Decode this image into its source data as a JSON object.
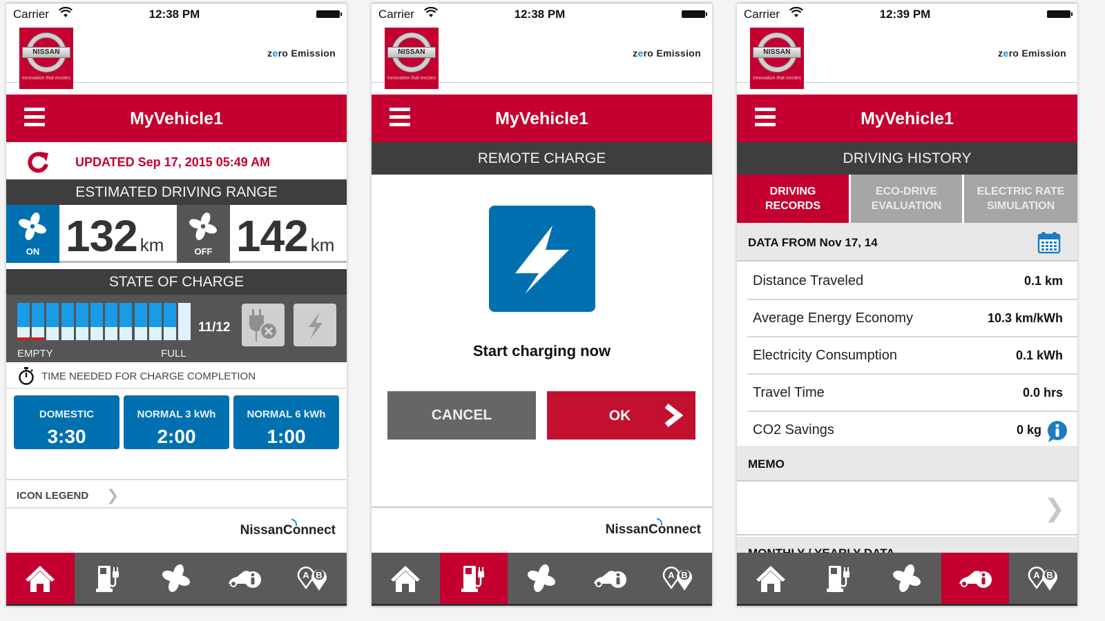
{
  "colors": {
    "brand_red": "#c3002f",
    "nissan_blue": "#0070b0",
    "dark_header": "#3e3e3e",
    "tabbar": "#5a5a5a",
    "battery_cell": "#1a9be6",
    "low_cell": "#e0161e"
  },
  "screens": [
    {
      "status": {
        "carrier": "Carrier",
        "time": "12:38 PM"
      },
      "brand": {
        "logo_text": "NISSAN",
        "tagline": "Innovation that excites",
        "zero_prefix": "z",
        "zero_o": "e",
        "zero_rest": "ro Emission"
      },
      "title": "MyVehicle1",
      "updated": "UPDATED Sep 17, 2015 05:49 AM",
      "range": {
        "header": "ESTIMATED DRIVING RANGE",
        "ac_on": {
          "label": "ON",
          "value": "132",
          "unit": "km"
        },
        "ac_off": {
          "label": "OFF",
          "value": "142",
          "unit": "km"
        }
      },
      "charge": {
        "header": "STATE OF CHARGE",
        "filled_cells": 11,
        "total_cells": 12,
        "low_cells": 2,
        "count_text": "11/12",
        "empty_label": "EMPTY",
        "full_label": "FULL"
      },
      "time_needed": "TIME NEEDED FOR CHARGE COMPLETION",
      "charge_times": [
        {
          "label": "DOMESTIC",
          "value": "3:30"
        },
        {
          "label": "NORMAL  3 kWh",
          "value": "2:00"
        },
        {
          "label": "NORMAL  6 kWh",
          "value": "1:00"
        }
      ],
      "icon_legend": "ICON LEGEND",
      "footer_logo": {
        "a": "Nissan",
        "c": "C",
        "b": "onnect"
      },
      "active_tab": 0
    },
    {
      "status": {
        "carrier": "Carrier",
        "time": "12:38 PM"
      },
      "title": "MyVehicle1",
      "section": "REMOTE CHARGE",
      "prompt": "Start charging now",
      "cancel": "CANCEL",
      "ok": "OK",
      "footer_logo": {
        "a": "Nissan",
        "c": "C",
        "b": "onnect"
      },
      "active_tab": 1
    },
    {
      "status": {
        "carrier": "Carrier",
        "time": "12:39 PM"
      },
      "title": "MyVehicle1",
      "section": "DRIVING HISTORY",
      "tabs": [
        {
          "line1": "DRIVING",
          "line2": "RECORDS",
          "active": true
        },
        {
          "line1": "ECO-DRIVE",
          "line2": "EVALUATION",
          "active": false
        },
        {
          "line1": "ELECTRIC RATE",
          "line2": "SIMULATION",
          "active": false
        }
      ],
      "data_from": "DATA FROM Nov 17, 14",
      "records": [
        {
          "label": "Distance Traveled",
          "value": "0.1 km"
        },
        {
          "label": "Average Energy Economy",
          "value": "10.3 km/kWh"
        },
        {
          "label": "Electricity Consumption",
          "value": "0.1 kWh"
        },
        {
          "label": "Travel Time",
          "value": "0.0 hrs"
        },
        {
          "label": "CO2 Savings",
          "value": "0 kg"
        }
      ],
      "memo": "MEMO",
      "monthly": "MONTHLY / YEARLY DATA",
      "active_tab": 3
    }
  ],
  "tabbar": [
    {
      "name": "home",
      "icon": "home-icon"
    },
    {
      "name": "charging",
      "icon": "charging-station-icon"
    },
    {
      "name": "climate",
      "icon": "fan-icon"
    },
    {
      "name": "vehicle-info",
      "icon": "car-info-icon"
    },
    {
      "name": "route",
      "icon": "route-ab-icon"
    }
  ]
}
